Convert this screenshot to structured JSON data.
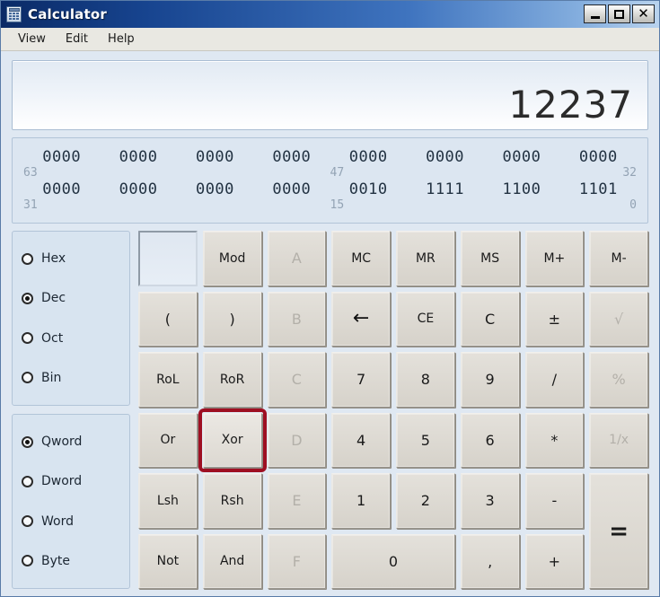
{
  "window": {
    "title": "Calculator",
    "icon": "calculator-icon",
    "controls": {
      "minimize": "minimize-icon",
      "maximize": "maximize-icon",
      "close": "close-icon"
    }
  },
  "menubar": {
    "items": [
      {
        "label": "View"
      },
      {
        "label": "Edit"
      },
      {
        "label": "Help"
      }
    ]
  },
  "display": {
    "value": "12237"
  },
  "binary_display": {
    "rows": [
      {
        "nibbles": [
          "0000",
          "0000",
          "0000",
          "0000",
          "0000",
          "0000",
          "0000",
          "0000"
        ],
        "label_left": "63",
        "label_mid": "47",
        "label_right": "32"
      },
      {
        "nibbles": [
          "0000",
          "0000",
          "0000",
          "0000",
          "0010",
          "1111",
          "1100",
          "1101"
        ],
        "label_left": "31",
        "label_mid": "15",
        "label_right": "0"
      }
    ]
  },
  "base_group": {
    "name": "number-base",
    "selected": "Dec",
    "options": [
      {
        "label": "Hex",
        "checked": false
      },
      {
        "label": "Dec",
        "checked": true
      },
      {
        "label": "Oct",
        "checked": false
      },
      {
        "label": "Bin",
        "checked": false
      }
    ]
  },
  "wordsize_group": {
    "name": "word-size",
    "selected": "Qword",
    "options": [
      {
        "label": "Qword",
        "checked": true
      },
      {
        "label": "Dword",
        "checked": false
      },
      {
        "label": "Word",
        "checked": false
      },
      {
        "label": "Byte",
        "checked": false
      }
    ]
  },
  "keypad": {
    "highlighted_key": "Xor",
    "keys": [
      {
        "name": "entry-input",
        "label": "",
        "type": "input",
        "disabled": false
      },
      {
        "name": "key-mod",
        "label": "Mod",
        "type": "op",
        "disabled": false
      },
      {
        "name": "key-hex-a",
        "label": "A",
        "type": "hexdigit",
        "disabled": true
      },
      {
        "name": "key-memory-clear",
        "label": "MC",
        "type": "memory",
        "disabled": false
      },
      {
        "name": "key-memory-recall",
        "label": "MR",
        "type": "memory",
        "disabled": false
      },
      {
        "name": "key-memory-store",
        "label": "MS",
        "type": "memory",
        "disabled": false
      },
      {
        "name": "key-memory-add",
        "label": "M+",
        "type": "memory",
        "disabled": false
      },
      {
        "name": "key-memory-sub",
        "label": "M-",
        "type": "memory",
        "disabled": false
      },
      {
        "name": "key-paren-open",
        "label": "(",
        "type": "op",
        "disabled": false
      },
      {
        "name": "key-paren-close",
        "label": ")",
        "type": "op",
        "disabled": false
      },
      {
        "name": "key-hex-b",
        "label": "B",
        "type": "hexdigit",
        "disabled": true
      },
      {
        "name": "key-backspace",
        "label": "←",
        "type": "edit",
        "disabled": false
      },
      {
        "name": "key-clear-entry",
        "label": "CE",
        "type": "edit",
        "disabled": false
      },
      {
        "name": "key-clear",
        "label": "C",
        "type": "edit",
        "disabled": false
      },
      {
        "name": "key-sign",
        "label": "±",
        "type": "edit",
        "disabled": false
      },
      {
        "name": "key-sqrt",
        "label": "√",
        "type": "func",
        "disabled": true
      },
      {
        "name": "key-rol",
        "label": "RoL",
        "type": "op",
        "disabled": false
      },
      {
        "name": "key-ror",
        "label": "RoR",
        "type": "op",
        "disabled": false
      },
      {
        "name": "key-hex-c",
        "label": "C",
        "type": "hexdigit",
        "disabled": true
      },
      {
        "name": "key-digit-7",
        "label": "7",
        "type": "digit",
        "disabled": false
      },
      {
        "name": "key-digit-8",
        "label": "8",
        "type": "digit",
        "disabled": false
      },
      {
        "name": "key-digit-9",
        "label": "9",
        "type": "digit",
        "disabled": false
      },
      {
        "name": "key-divide",
        "label": "/",
        "type": "op",
        "disabled": false
      },
      {
        "name": "key-percent",
        "label": "%",
        "type": "func",
        "disabled": true
      },
      {
        "name": "key-or",
        "label": "Or",
        "type": "op",
        "disabled": false
      },
      {
        "name": "key-xor",
        "label": "Xor",
        "type": "op",
        "disabled": false
      },
      {
        "name": "key-hex-d",
        "label": "D",
        "type": "hexdigit",
        "disabled": true
      },
      {
        "name": "key-digit-4",
        "label": "4",
        "type": "digit",
        "disabled": false
      },
      {
        "name": "key-digit-5",
        "label": "5",
        "type": "digit",
        "disabled": false
      },
      {
        "name": "key-digit-6",
        "label": "6",
        "type": "digit",
        "disabled": false
      },
      {
        "name": "key-multiply",
        "label": "*",
        "type": "op",
        "disabled": false
      },
      {
        "name": "key-reciprocal",
        "label": "1/x",
        "type": "func",
        "disabled": true
      },
      {
        "name": "key-lsh",
        "label": "Lsh",
        "type": "op",
        "disabled": false
      },
      {
        "name": "key-rsh",
        "label": "Rsh",
        "type": "op",
        "disabled": false
      },
      {
        "name": "key-hex-e",
        "label": "E",
        "type": "hexdigit",
        "disabled": true
      },
      {
        "name": "key-digit-1",
        "label": "1",
        "type": "digit",
        "disabled": false
      },
      {
        "name": "key-digit-2",
        "label": "2",
        "type": "digit",
        "disabled": false
      },
      {
        "name": "key-digit-3",
        "label": "3",
        "type": "digit",
        "disabled": false
      },
      {
        "name": "key-subtract",
        "label": "-",
        "type": "op",
        "disabled": false
      },
      {
        "name": "key-equals",
        "label": "=",
        "type": "op",
        "disabled": false
      },
      {
        "name": "key-not",
        "label": "Not",
        "type": "op",
        "disabled": false
      },
      {
        "name": "key-and",
        "label": "And",
        "type": "op",
        "disabled": false
      },
      {
        "name": "key-hex-f",
        "label": "F",
        "type": "hexdigit",
        "disabled": true
      },
      {
        "name": "key-digit-0",
        "label": "0",
        "type": "digit",
        "disabled": false
      },
      {
        "name": "key-decimal",
        "label": ",",
        "type": "digit",
        "disabled": false
      },
      {
        "name": "key-add",
        "label": "+",
        "type": "op",
        "disabled": false
      }
    ]
  },
  "colors": {
    "titlebar_start": "#0a2a66",
    "titlebar_end": "#b9d3ee",
    "client_bg": "#dfe8f2",
    "panel_bg": "#dce6f1",
    "key_face": "#ded9d2",
    "highlight_red": "#9e0f22",
    "bit_label": "#93a3b4",
    "display_text": "#2b2b2b"
  }
}
